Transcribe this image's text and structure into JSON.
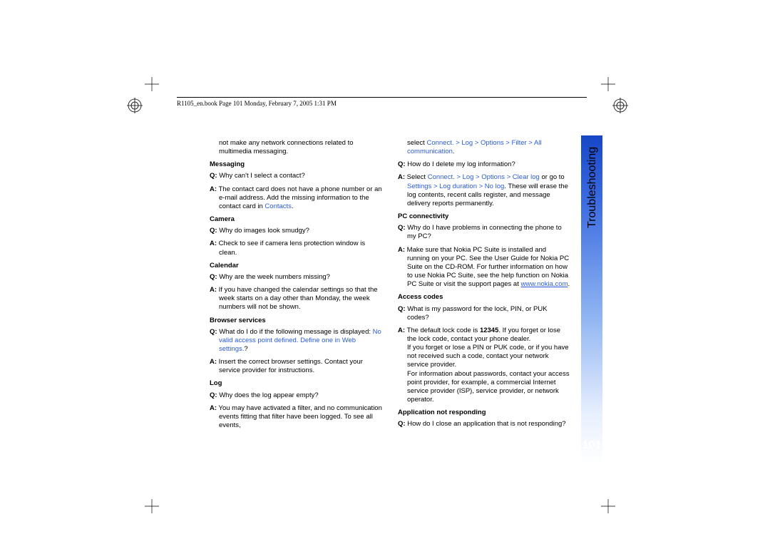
{
  "header": {
    "running_head": "R1105_en.book  Page 101  Monday, February 7, 2005  1:31 PM"
  },
  "side": {
    "section_title": "Troubleshooting",
    "page_number": "101"
  },
  "left": {
    "intro_continuation": "not make any network connections related to multimedia messaging.",
    "messaging_head": "Messaging",
    "messaging_q": "Why can't I select a contact?",
    "messaging_a_pre": "The contact card does not have a phone number or an e-mail address. Add the missing information to the contact card in ",
    "messaging_a_link": "Contacts",
    "messaging_a_post": ".",
    "camera_head": "Camera",
    "camera_q": "Why do images look smudgy?",
    "camera_a": "Check to see if camera lens protection window is clean.",
    "calendar_head": "Calendar",
    "calendar_q": "Why are the week numbers missing?",
    "calendar_a": "If you have changed the calendar settings so that the week starts on a day other than Monday, the week numbers will not be shown.",
    "browser_head": "Browser services",
    "browser_q_pre": "What do I do if the following message is displayed: ",
    "browser_q_link": "No valid access point defined. Define one in Web settings.",
    "browser_q_post": "?",
    "browser_a": "Insert the correct browser settings. Contact your service provider for instructions.",
    "log_head": "Log",
    "log_q": "Why does the log appear empty?",
    "log_a": "You may have activated a filter, and no communication events fitting that filter have been logged. To see all events,"
  },
  "right": {
    "log_cont_pre": "select ",
    "log_cont_link": "Connect. > Log > Options > Filter > All communication",
    "log_cont_post": ".",
    "log_q2": "How do I delete my log information?",
    "log_a2_pre": "Select ",
    "log_a2_link1": "Connect. > Log > Options > Clear log",
    "log_a2_mid": " or go to ",
    "log_a2_link2": "Settings > Log duration > No log",
    "log_a2_post": ". These will erase the log contents, recent calls register, and message delivery reports permanently.",
    "pc_head": "PC connectivity",
    "pc_q": "Why do I have problems in connecting the phone to my PC?",
    "pc_a_pre": "Make sure that Nokia PC Suite is installed and running on your PC. See the User Guide for Nokia PC Suite on the CD-ROM. For further information on how to use Nokia PC Suite, see the help function on Nokia PC Suite or visit the support pages at ",
    "pc_a_link": "www.nokia.com",
    "pc_a_post": ".",
    "access_head": "Access codes",
    "access_q": "What is my password for the lock, PIN, or PUK codes?",
    "access_a_pre": "The default lock code is ",
    "access_a_code": "12345",
    "access_a_post": ". If you forget or lose the lock code, contact your phone dealer.\nIf you forget or lose a PIN or PUK code, or if you have not received such a code, contact your network service provider.\nFor information about passwords, contact your access point provider, for example, a commercial Internet service provider (ISP), service provider, or network operator.",
    "app_head": "Application not responding",
    "app_q": "How do I close an application that is not responding?"
  },
  "labels": {
    "q": "Q:",
    "a": "A:"
  }
}
